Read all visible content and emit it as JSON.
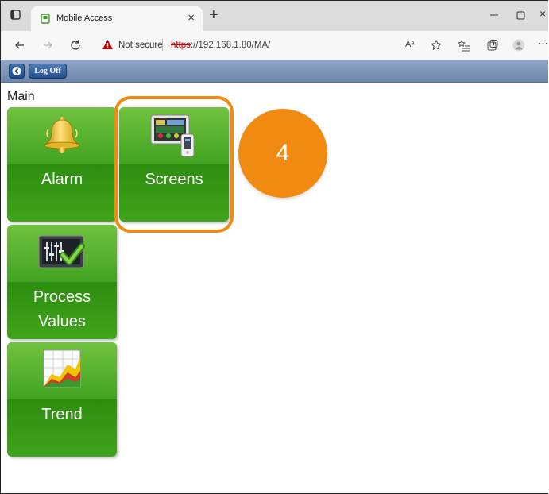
{
  "browser": {
    "tab_title": "Mobile Access",
    "tab_close": "×",
    "new_tab": "+",
    "window_close": "×",
    "security_label": "Not secure",
    "url_scheme": "https",
    "url_rest": "://192.168.1.80/MA/",
    "read_aloud_label": "Aᵃ"
  },
  "app_header": {
    "logoff_label": "Log Off"
  },
  "breadcrumb": "Main",
  "tiles": [
    {
      "label": "Alarm",
      "icon": "bell-icon"
    },
    {
      "label": "Screens",
      "icon": "screens-icon"
    },
    {
      "label": "Process Values",
      "label_line1": "Process",
      "label_line2": "Values",
      "icon": "process-values-icon"
    },
    {
      "label": "Trend",
      "icon": "trend-chart-icon"
    }
  ],
  "annotation": {
    "step_number": "4",
    "color": "#f08a11"
  },
  "colors": {
    "tile_green": "#3f9a1c",
    "header_blue": "#7d94b8",
    "url_scheme_red": "#c00000"
  }
}
